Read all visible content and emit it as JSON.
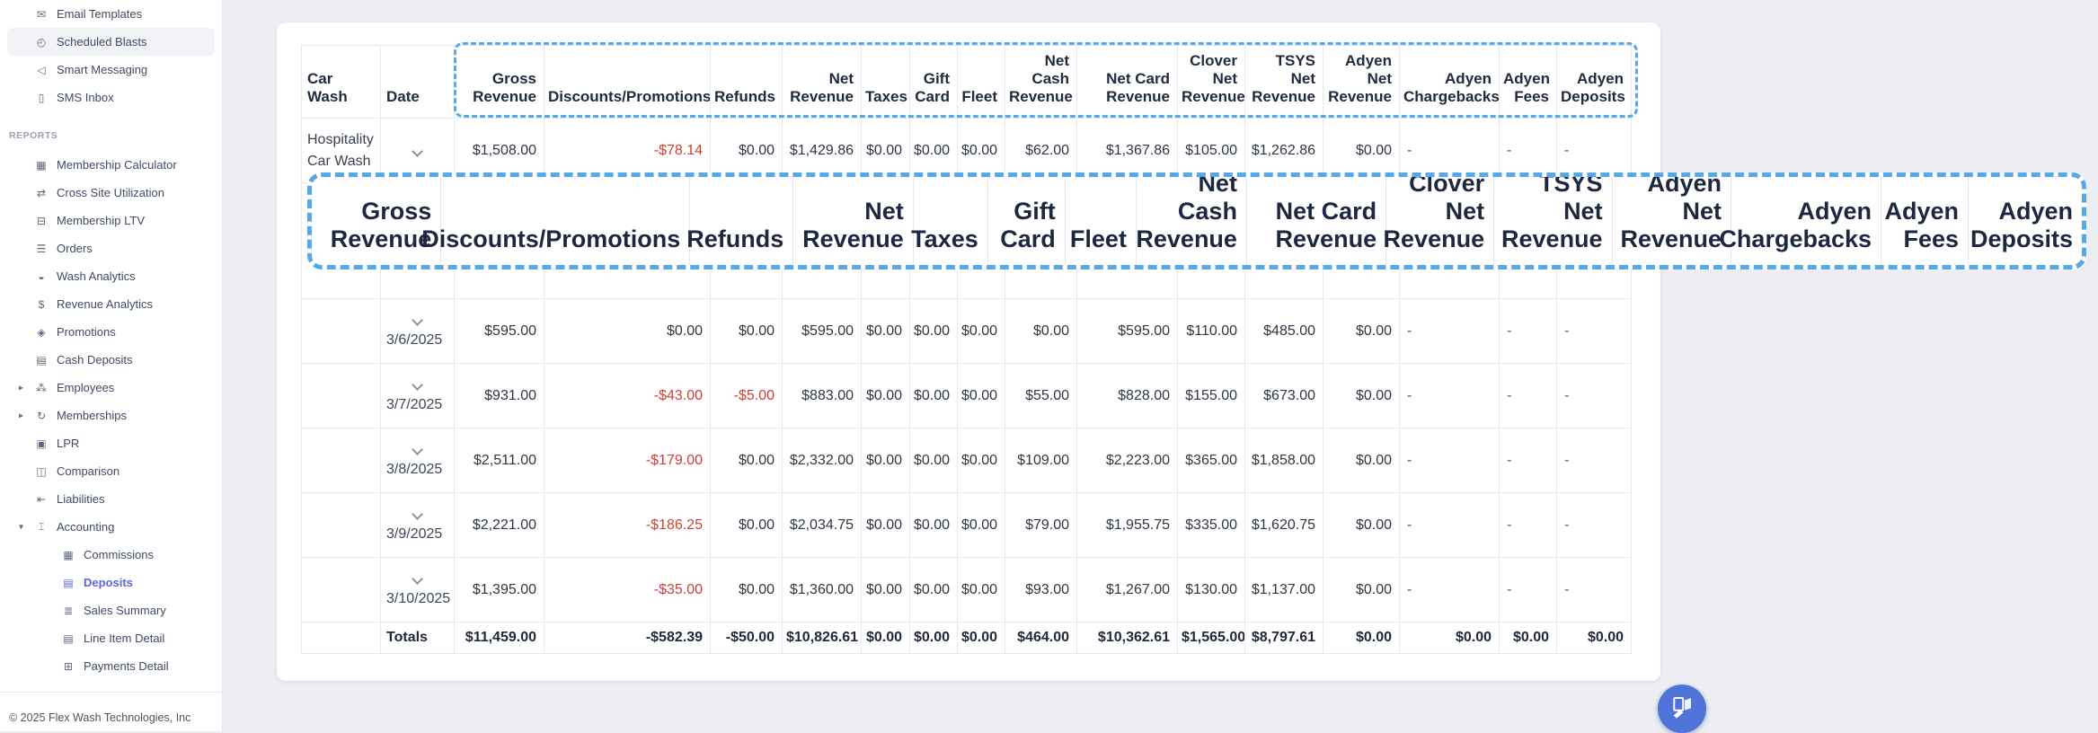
{
  "sidebar": {
    "top_items": [
      {
        "label": "Email Templates",
        "icon": "email-icon"
      },
      {
        "label": "Scheduled Blasts",
        "icon": "clock-icon",
        "highlighted": true
      },
      {
        "label": "Smart Messaging",
        "icon": "megaphone-icon"
      },
      {
        "label": "SMS Inbox",
        "icon": "phone-icon"
      }
    ],
    "reports_label": "REPORTS",
    "report_items": [
      {
        "label": "Membership Calculator",
        "icon": "calculator-icon"
      },
      {
        "label": "Cross Site Utilization",
        "icon": "shuffle-icon"
      },
      {
        "label": "Membership LTV",
        "icon": "banknote-icon"
      },
      {
        "label": "Orders",
        "icon": "orders-icon"
      },
      {
        "label": "Wash Analytics",
        "icon": "car-icon"
      },
      {
        "label": "Revenue Analytics",
        "icon": "dollar-icon"
      },
      {
        "label": "Promotions",
        "icon": "tag-icon"
      },
      {
        "label": "Cash Deposits",
        "icon": "cash-icon"
      },
      {
        "label": "Employees",
        "icon": "people-icon",
        "caret": "collapsed"
      },
      {
        "label": "Memberships",
        "icon": "refresh-icon",
        "caret": "collapsed"
      },
      {
        "label": "LPR",
        "icon": "camera-icon"
      },
      {
        "label": "Comparison",
        "icon": "book-icon"
      },
      {
        "label": "Liabilities",
        "icon": "rewind-icon"
      },
      {
        "label": "Accounting",
        "icon": "bank-icon",
        "caret": "expanded"
      },
      {
        "label": "Commissions",
        "icon": "grid-icon",
        "sub": true
      },
      {
        "label": "Deposits",
        "icon": "deposits-icon",
        "sub": true,
        "active": true
      },
      {
        "label": "Sales Summary",
        "icon": "list-icon",
        "sub": true
      },
      {
        "label": "Line Item Detail",
        "icon": "detail-icon",
        "sub": true
      },
      {
        "label": "Payments Detail",
        "icon": "payments-icon",
        "sub": true
      }
    ],
    "footer": "© 2025 Flex Wash Technologies, Inc"
  },
  "table": {
    "columns": [
      {
        "key": "car_wash",
        "label": "Car Wash",
        "align": "left"
      },
      {
        "key": "date",
        "label": "Date",
        "align": "left"
      },
      {
        "key": "gross_revenue",
        "label": "Gross\nRevenue",
        "align": "right"
      },
      {
        "key": "discounts_promotions",
        "label": "Discounts/Promotions",
        "align": "right"
      },
      {
        "key": "refunds",
        "label": "Refunds",
        "align": "right"
      },
      {
        "key": "net_revenue",
        "label": "Net\nRevenue",
        "align": "right"
      },
      {
        "key": "taxes",
        "label": "Taxes",
        "align": "right"
      },
      {
        "key": "gift_card",
        "label": "Gift\nCard",
        "align": "right"
      },
      {
        "key": "fleet",
        "label": "Fleet",
        "align": "right"
      },
      {
        "key": "net_cash_revenue",
        "label": "Net Cash\nRevenue",
        "align": "right"
      },
      {
        "key": "net_card_revenue",
        "label": "Net Card\nRevenue",
        "align": "right"
      },
      {
        "key": "clover_net_revenue",
        "label": "Clover\nNet\nRevenue",
        "align": "right"
      },
      {
        "key": "tsys_net_revenue",
        "label": "TSYS Net\nRevenue",
        "align": "right"
      },
      {
        "key": "adyen_net_revenue",
        "label": "Adyen\nNet\nRevenue",
        "align": "right"
      },
      {
        "key": "adyen_chargebacks",
        "label": "Adyen\nChargebacks",
        "align": "right"
      },
      {
        "key": "adyen_fees",
        "label": "Adyen\nFees",
        "align": "right"
      },
      {
        "key": "adyen_deposits",
        "label": "Adyen\nDeposits",
        "align": "right"
      }
    ],
    "first_row": {
      "car_wash": "Hospitality Car Wash",
      "values": [
        "$1,508.00",
        "-$78.14",
        "$0.00",
        "$1,429.86",
        "$0.00",
        "$0.00",
        "$0.00",
        "$62.00",
        "$1,367.86",
        "$105.00",
        "$1,262.86",
        "$0.00",
        "-",
        "-",
        "-"
      ]
    },
    "rows": [
      {
        "date": "3/6/2025",
        "values": [
          "$595.00",
          "$0.00",
          "$0.00",
          "$595.00",
          "$0.00",
          "$0.00",
          "$0.00",
          "$0.00",
          "$595.00",
          "$110.00",
          "$485.00",
          "$0.00",
          "-",
          "-",
          "-"
        ]
      },
      {
        "date": "3/7/2025",
        "values": [
          "$931.00",
          "-$43.00",
          "-$5.00",
          "$883.00",
          "$0.00",
          "$0.00",
          "$0.00",
          "$55.00",
          "$828.00",
          "$155.00",
          "$673.00",
          "$0.00",
          "-",
          "-",
          "-"
        ]
      },
      {
        "date": "3/8/2025",
        "values": [
          "$2,511.00",
          "-$179.00",
          "$0.00",
          "$2,332.00",
          "$0.00",
          "$0.00",
          "$0.00",
          "$109.00",
          "$2,223.00",
          "$365.00",
          "$1,858.00",
          "$0.00",
          "-",
          "-",
          "-"
        ]
      },
      {
        "date": "3/9/2025",
        "values": [
          "$2,221.00",
          "-$186.25",
          "$0.00",
          "$2,034.75",
          "$0.00",
          "$0.00",
          "$0.00",
          "$79.00",
          "$1,955.75",
          "$335.00",
          "$1,620.75",
          "$0.00",
          "-",
          "-",
          "-"
        ]
      },
      {
        "date": "3/10/2025",
        "values": [
          "$1,395.00",
          "-$35.00",
          "$0.00",
          "$1,360.00",
          "$0.00",
          "$0.00",
          "$0.00",
          "$93.00",
          "$1,267.00",
          "$130.00",
          "$1,137.00",
          "$0.00",
          "-",
          "-",
          "-"
        ]
      }
    ],
    "totals": {
      "label": "Totals",
      "values": [
        "$11,459.00",
        "-$582.39",
        "-$50.00",
        "$10,826.61",
        "$0.00",
        "$0.00",
        "$0.00",
        "$464.00",
        "$10,362.61",
        "$1,565.00",
        "$8,797.61",
        "$0.00",
        "$0.00",
        "$0.00",
        "$0.00"
      ]
    }
  },
  "magnifier": {
    "labels": [
      "Gross\nRevenue",
      "Discounts/Promotions",
      "Refunds",
      "Net\nRevenue",
      "Taxes",
      "Gift\nCard",
      "Fleet",
      "Net Cash\nRevenue",
      "Net Card\nRevenue",
      "Clover\nNet\nRevenue",
      "TSYS Net\nRevenue",
      "Adyen\nNet\nRevenue",
      "Adyen\nChargebacks",
      "Adyen\nFees",
      "Adyen\nDeposits"
    ]
  },
  "colors": {
    "accent_blue_dash": "#56a8e7",
    "negative_red": "#cb4335",
    "active_indigo": "#5b67d8",
    "fab_blue": "#4e74d8"
  }
}
